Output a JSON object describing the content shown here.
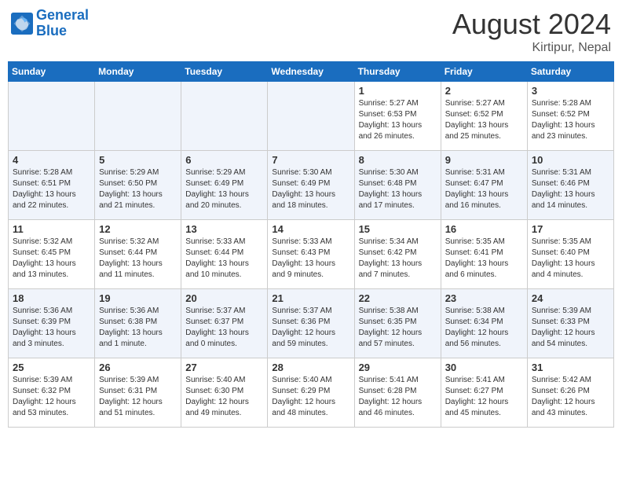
{
  "logo": {
    "line1": "General",
    "line2": "Blue"
  },
  "title": "August 2024",
  "location": "Kirtipur, Nepal",
  "days_of_week": [
    "Sunday",
    "Monday",
    "Tuesday",
    "Wednesday",
    "Thursday",
    "Friday",
    "Saturday"
  ],
  "weeks": [
    [
      {
        "day": "",
        "info": ""
      },
      {
        "day": "",
        "info": ""
      },
      {
        "day": "",
        "info": ""
      },
      {
        "day": "",
        "info": ""
      },
      {
        "day": "1",
        "sunrise": "5:27 AM",
        "sunset": "6:53 PM",
        "daylight": "13 hours and 26 minutes."
      },
      {
        "day": "2",
        "sunrise": "5:27 AM",
        "sunset": "6:52 PM",
        "daylight": "13 hours and 25 minutes."
      },
      {
        "day": "3",
        "sunrise": "5:28 AM",
        "sunset": "6:52 PM",
        "daylight": "13 hours and 23 minutes."
      }
    ],
    [
      {
        "day": "4",
        "sunrise": "5:28 AM",
        "sunset": "6:51 PM",
        "daylight": "13 hours and 22 minutes."
      },
      {
        "day": "5",
        "sunrise": "5:29 AM",
        "sunset": "6:50 PM",
        "daylight": "13 hours and 21 minutes."
      },
      {
        "day": "6",
        "sunrise": "5:29 AM",
        "sunset": "6:49 PM",
        "daylight": "13 hours and 20 minutes."
      },
      {
        "day": "7",
        "sunrise": "5:30 AM",
        "sunset": "6:49 PM",
        "daylight": "13 hours and 18 minutes."
      },
      {
        "day": "8",
        "sunrise": "5:30 AM",
        "sunset": "6:48 PM",
        "daylight": "13 hours and 17 minutes."
      },
      {
        "day": "9",
        "sunrise": "5:31 AM",
        "sunset": "6:47 PM",
        "daylight": "13 hours and 16 minutes."
      },
      {
        "day": "10",
        "sunrise": "5:31 AM",
        "sunset": "6:46 PM",
        "daylight": "13 hours and 14 minutes."
      }
    ],
    [
      {
        "day": "11",
        "sunrise": "5:32 AM",
        "sunset": "6:45 PM",
        "daylight": "13 hours and 13 minutes."
      },
      {
        "day": "12",
        "sunrise": "5:32 AM",
        "sunset": "6:44 PM",
        "daylight": "13 hours and 11 minutes."
      },
      {
        "day": "13",
        "sunrise": "5:33 AM",
        "sunset": "6:44 PM",
        "daylight": "13 hours and 10 minutes."
      },
      {
        "day": "14",
        "sunrise": "5:33 AM",
        "sunset": "6:43 PM",
        "daylight": "13 hours and 9 minutes."
      },
      {
        "day": "15",
        "sunrise": "5:34 AM",
        "sunset": "6:42 PM",
        "daylight": "13 hours and 7 minutes."
      },
      {
        "day": "16",
        "sunrise": "5:35 AM",
        "sunset": "6:41 PM",
        "daylight": "13 hours and 6 minutes."
      },
      {
        "day": "17",
        "sunrise": "5:35 AM",
        "sunset": "6:40 PM",
        "daylight": "13 hours and 4 minutes."
      }
    ],
    [
      {
        "day": "18",
        "sunrise": "5:36 AM",
        "sunset": "6:39 PM",
        "daylight": "13 hours and 3 minutes."
      },
      {
        "day": "19",
        "sunrise": "5:36 AM",
        "sunset": "6:38 PM",
        "daylight": "13 hours and 1 minute."
      },
      {
        "day": "20",
        "sunrise": "5:37 AM",
        "sunset": "6:37 PM",
        "daylight": "13 hours and 0 minutes."
      },
      {
        "day": "21",
        "sunrise": "5:37 AM",
        "sunset": "6:36 PM",
        "daylight": "12 hours and 59 minutes."
      },
      {
        "day": "22",
        "sunrise": "5:38 AM",
        "sunset": "6:35 PM",
        "daylight": "12 hours and 57 minutes."
      },
      {
        "day": "23",
        "sunrise": "5:38 AM",
        "sunset": "6:34 PM",
        "daylight": "12 hours and 56 minutes."
      },
      {
        "day": "24",
        "sunrise": "5:39 AM",
        "sunset": "6:33 PM",
        "daylight": "12 hours and 54 minutes."
      }
    ],
    [
      {
        "day": "25",
        "sunrise": "5:39 AM",
        "sunset": "6:32 PM",
        "daylight": "12 hours and 53 minutes."
      },
      {
        "day": "26",
        "sunrise": "5:39 AM",
        "sunset": "6:31 PM",
        "daylight": "12 hours and 51 minutes."
      },
      {
        "day": "27",
        "sunrise": "5:40 AM",
        "sunset": "6:30 PM",
        "daylight": "12 hours and 49 minutes."
      },
      {
        "day": "28",
        "sunrise": "5:40 AM",
        "sunset": "6:29 PM",
        "daylight": "12 hours and 48 minutes."
      },
      {
        "day": "29",
        "sunrise": "5:41 AM",
        "sunset": "6:28 PM",
        "daylight": "12 hours and 46 minutes."
      },
      {
        "day": "30",
        "sunrise": "5:41 AM",
        "sunset": "6:27 PM",
        "daylight": "12 hours and 45 minutes."
      },
      {
        "day": "31",
        "sunrise": "5:42 AM",
        "sunset": "6:26 PM",
        "daylight": "12 hours and 43 minutes."
      }
    ]
  ]
}
